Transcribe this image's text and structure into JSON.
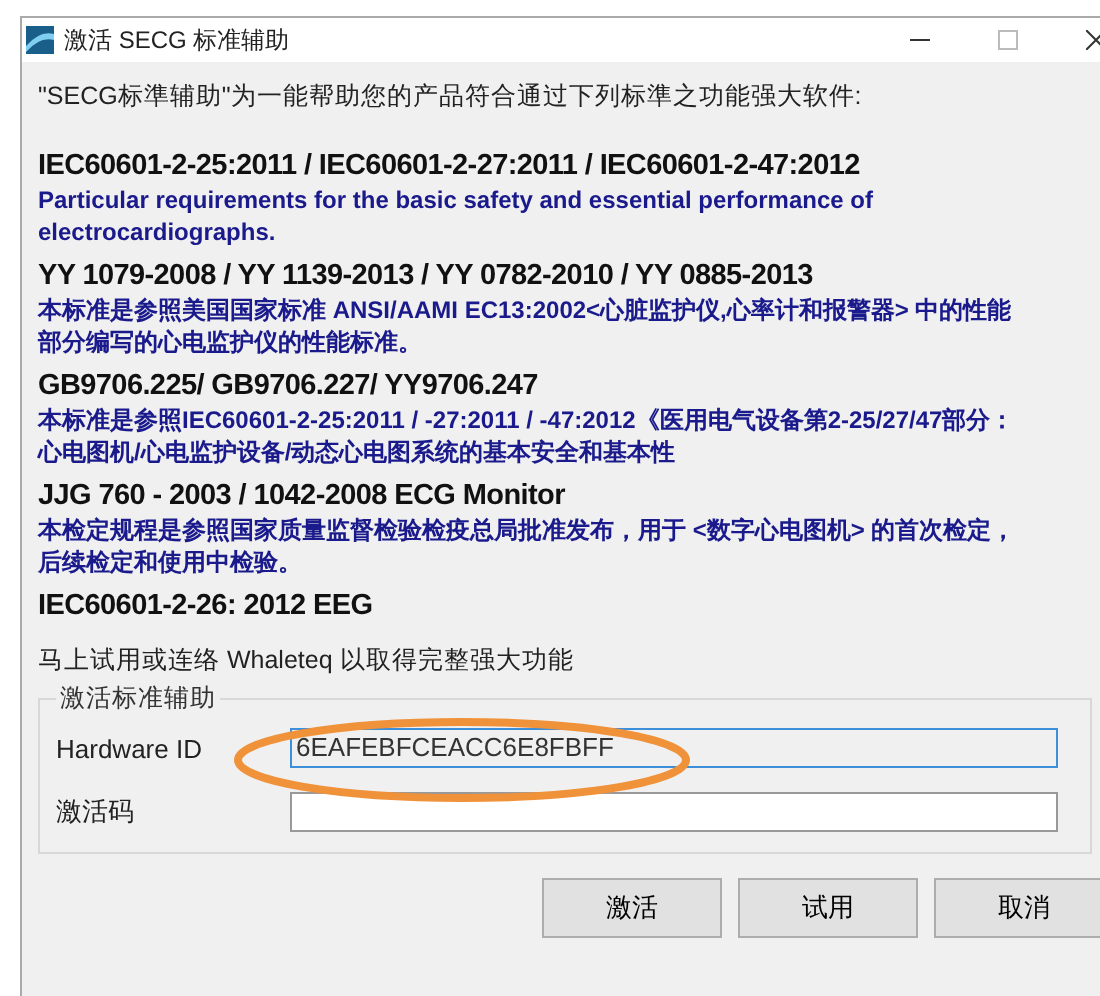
{
  "window": {
    "title": "激活 SECG 标准辅助"
  },
  "intro": "\"SECG标準辅助\"为一能帮助您的产品符合通过下列标準之功能强大软件:",
  "standards": [
    {
      "title": "IEC60601-2-25:2011 / IEC60601-2-27:2011 / IEC60601-2-47:2012",
      "description": "Particular requirements for the basic safety and essential performance of electrocardiographs."
    },
    {
      "title": "YY 1079-2008 / YY 1139-2013 / YY 0782-2010 / YY 0885-2013",
      "description": "本标准是参照美国国家标准 ANSI/AAMI EC13:2002<心脏监护仪,心率计和报警器> 中的性能部分编写的心电监护仪的性能标准。"
    },
    {
      "title": "GB9706.225/ GB9706.227/ YY9706.247",
      "description": "本标准是参照IEC60601-2-25:2011 / -27:2011 / -47:2012《医用电气设备第2-25/27/47部分：心电图机/心电监护设备/动态心电图系统的基本安全和基本性"
    },
    {
      "title": "JJG 760 - 2003 / 1042-2008 ECG Monitor",
      "description": "本检定规程是参照国家质量监督检验检疫总局批准发布，用于 <数字心电图机> 的首次检定，后续检定和使用中检验。"
    },
    {
      "title": "IEC60601-2-26: 2012 EEG"
    }
  ],
  "trial_note": "马上试用或连络 Whaleteq 以取得完整强大功能",
  "group": {
    "title": "激活标准辅助",
    "fields": [
      {
        "label": "Hardware ID",
        "value": "6EAFEBFCEACC6E8FBFF",
        "focused": true
      },
      {
        "label": "激活码",
        "focused": false
      }
    ]
  },
  "buttons": [
    "激活",
    "试用",
    "取消"
  ]
}
